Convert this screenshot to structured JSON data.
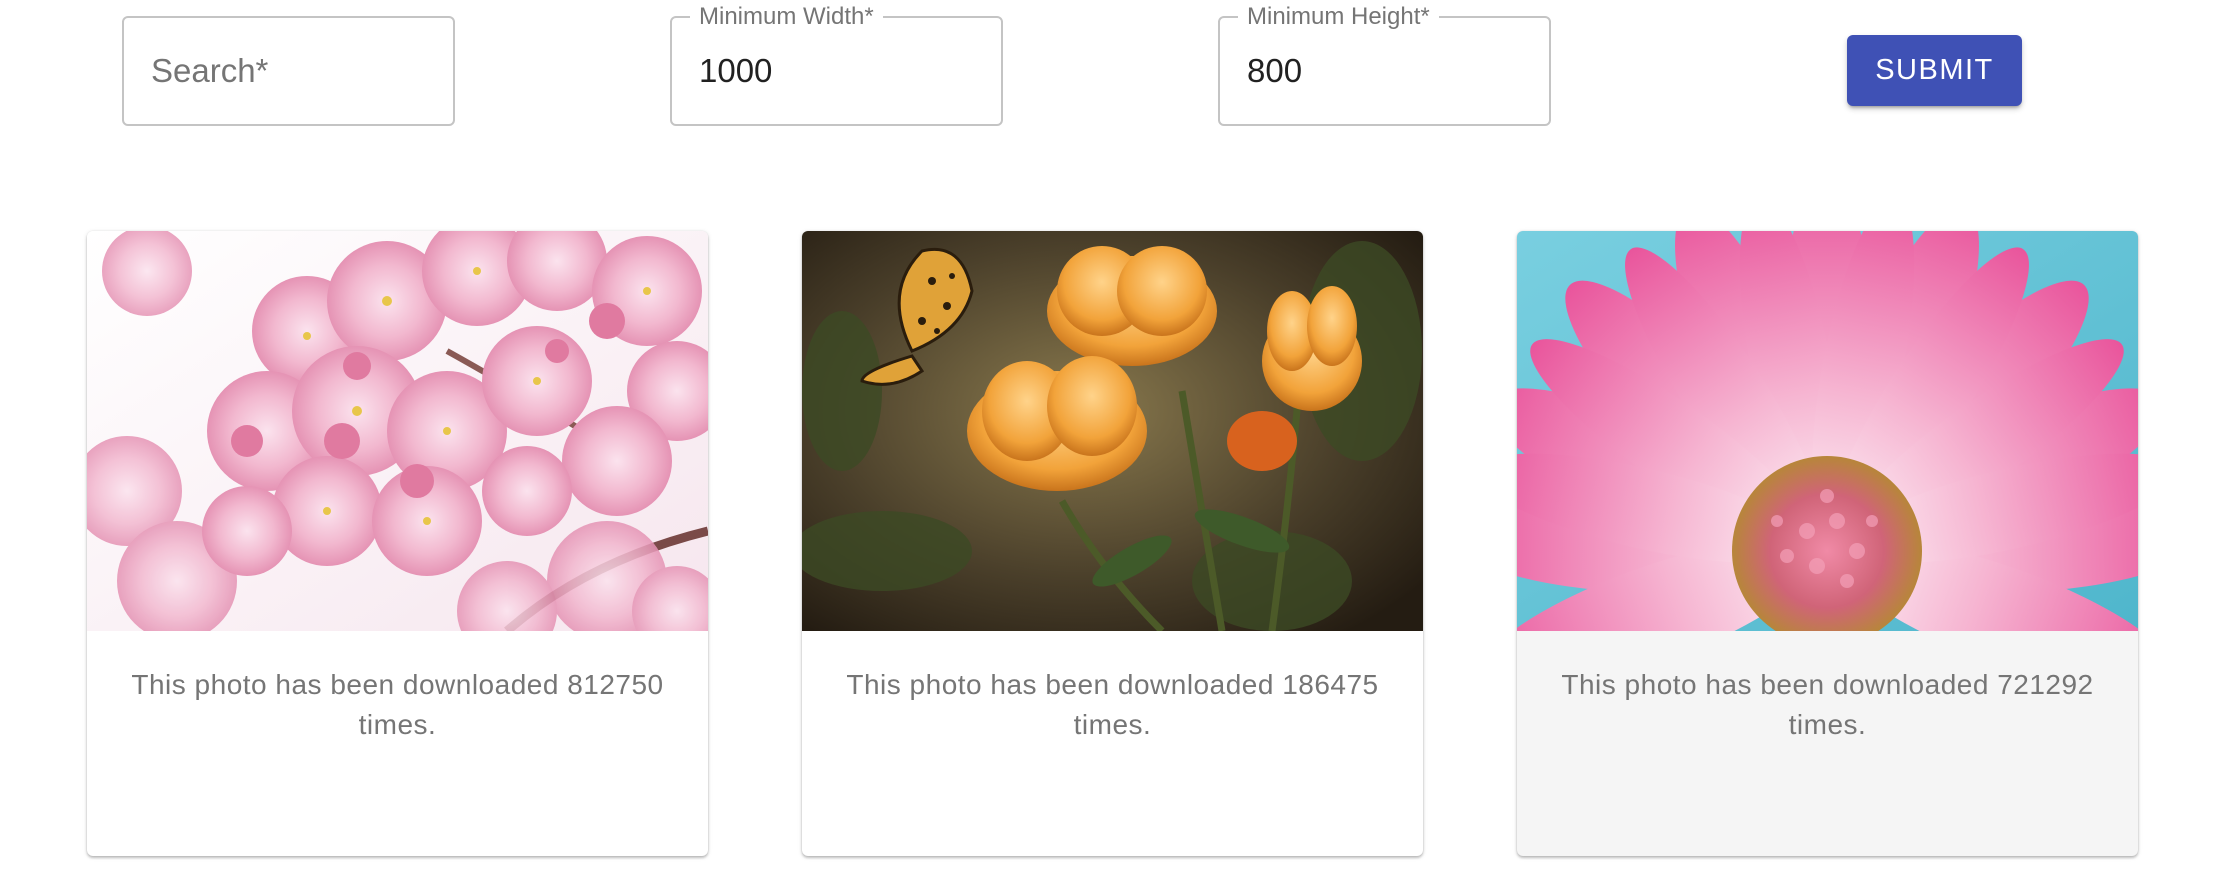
{
  "search": {
    "label": "Search*",
    "value": ""
  },
  "min_width": {
    "label": "Minimum Width*",
    "value": "1000"
  },
  "min_height": {
    "label": "Minimum Height*",
    "value": "800"
  },
  "submit_label": "SUBMIT",
  "cards": [
    {
      "caption": "This photo has been downloaded 812750 times.",
      "image": "cherry-blossom-photo"
    },
    {
      "caption": "This photo has been downloaded 186475 times.",
      "image": "orange-flowers-butterfly-photo"
    },
    {
      "caption": "This photo has been downloaded 721292 times.",
      "image": "pink-daisy-photo"
    }
  ],
  "colors": {
    "primary": "#3f51b5",
    "text_secondary": "#757575",
    "border": "#c4c4c4"
  }
}
